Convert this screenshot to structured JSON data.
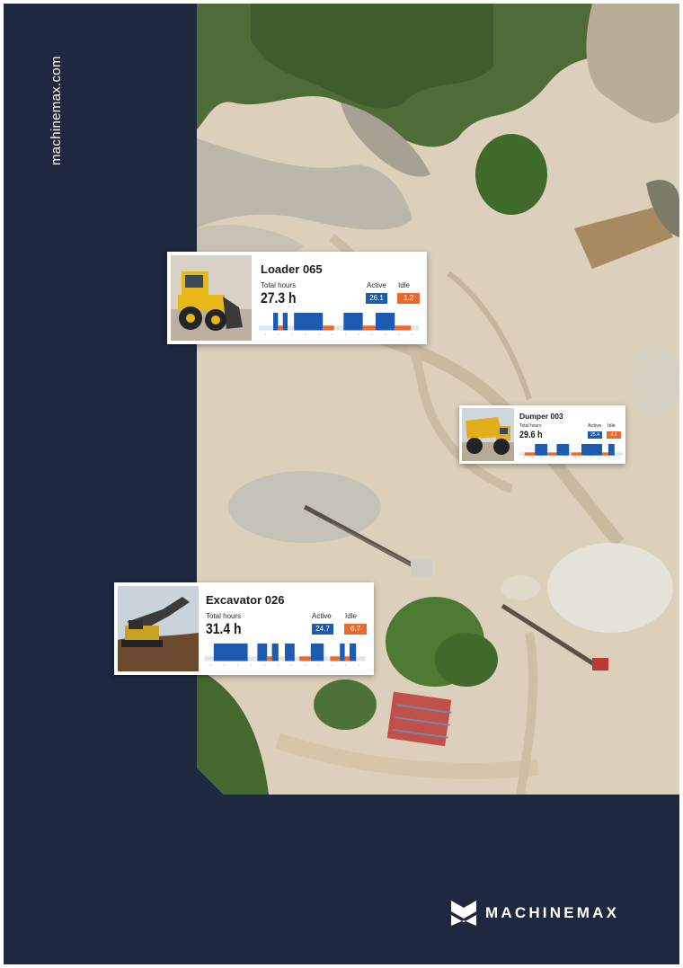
{
  "page": {
    "site_url": "machinemax.com",
    "brand_name": "MACHINEMAX",
    "background_color": "#1e2940",
    "active_color": "#1c5bb0",
    "idle_color": "#ea6a2d"
  },
  "machines": [
    {
      "name": "Loader 065",
      "total_hours_label": "Total hours",
      "total_hours": "27.3 h",
      "active_label": "Active",
      "active_hours": "26.1",
      "idle_label": "Idle",
      "idle_hours": "1.2",
      "photo_icon": "wheel-loader",
      "timeline": [
        {
          "state": "active",
          "start": 0.09,
          "end": 0.12
        },
        {
          "state": "idle",
          "start": 0.12,
          "end": 0.15
        },
        {
          "state": "active",
          "start": 0.15,
          "end": 0.18
        },
        {
          "state": "active",
          "start": 0.22,
          "end": 0.4
        },
        {
          "state": "idle",
          "start": 0.4,
          "end": 0.47
        },
        {
          "state": "active",
          "start": 0.53,
          "end": 0.65
        },
        {
          "state": "idle",
          "start": 0.65,
          "end": 0.73
        },
        {
          "state": "active",
          "start": 0.73,
          "end": 0.85
        },
        {
          "state": "idle",
          "start": 0.85,
          "end": 0.95
        }
      ]
    },
    {
      "name": "Dumper 003",
      "total_hours_label": "Total hours",
      "total_hours": "29.6 h",
      "active_label": "Active",
      "active_hours": "25.4",
      "idle_label": "Idle",
      "idle_hours": "4.2",
      "photo_icon": "dump-truck",
      "timeline": [
        {
          "state": "idle",
          "start": 0.05,
          "end": 0.15
        },
        {
          "state": "active",
          "start": 0.15,
          "end": 0.27
        },
        {
          "state": "idle",
          "start": 0.27,
          "end": 0.36
        },
        {
          "state": "active",
          "start": 0.36,
          "end": 0.48
        },
        {
          "state": "idle",
          "start": 0.5,
          "end": 0.6
        },
        {
          "state": "active",
          "start": 0.6,
          "end": 0.8
        },
        {
          "state": "idle",
          "start": 0.8,
          "end": 0.86
        },
        {
          "state": "active",
          "start": 0.86,
          "end": 0.92
        }
      ]
    },
    {
      "name": "Excavator 026",
      "total_hours_label": "Total hours",
      "total_hours": "31.4 h",
      "active_label": "Active",
      "active_hours": "24.7",
      "idle_label": "Idle",
      "idle_hours": "6.7",
      "photo_icon": "excavator",
      "timeline": [
        {
          "state": "active",
          "start": 0.06,
          "end": 0.27
        },
        {
          "state": "active",
          "start": 0.33,
          "end": 0.39
        },
        {
          "state": "idle",
          "start": 0.39,
          "end": 0.42
        },
        {
          "state": "active",
          "start": 0.42,
          "end": 0.46
        },
        {
          "state": "active",
          "start": 0.5,
          "end": 0.56
        },
        {
          "state": "idle",
          "start": 0.59,
          "end": 0.66
        },
        {
          "state": "active",
          "start": 0.66,
          "end": 0.74
        },
        {
          "state": "idle",
          "start": 0.78,
          "end": 0.84
        },
        {
          "state": "active",
          "start": 0.84,
          "end": 0.87
        },
        {
          "state": "idle",
          "start": 0.87,
          "end": 0.9
        },
        {
          "state": "active",
          "start": 0.9,
          "end": 0.94
        }
      ]
    }
  ]
}
